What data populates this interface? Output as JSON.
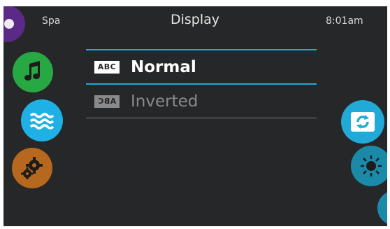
{
  "status": {
    "location": "Spa",
    "time": "8:01am"
  },
  "header": {
    "title": "Display"
  },
  "menu": {
    "items": [
      {
        "tag": "ABC",
        "label": "Normal",
        "selected": true
      },
      {
        "tag": "ABC",
        "label": "Inverted",
        "selected": false
      }
    ]
  },
  "left_nav": [
    {
      "icon": "spa-icon",
      "color": "#5b2a86"
    },
    {
      "icon": "music-note-icon",
      "color": "#27a843"
    },
    {
      "icon": "water-waves-icon",
      "color": "#1fb0e6"
    },
    {
      "icon": "gears-icon",
      "color": "#b5681e"
    }
  ],
  "right_nav": [
    {
      "icon": "rotate-icon",
      "color": "#21a9d8"
    },
    {
      "icon": "sun-brightness-icon",
      "color": "#1a8aa8"
    },
    {
      "icon": "user-icon",
      "color": "#1a8aa8"
    }
  ],
  "colors": {
    "accent": "#21a9d8",
    "background": "#262728"
  }
}
